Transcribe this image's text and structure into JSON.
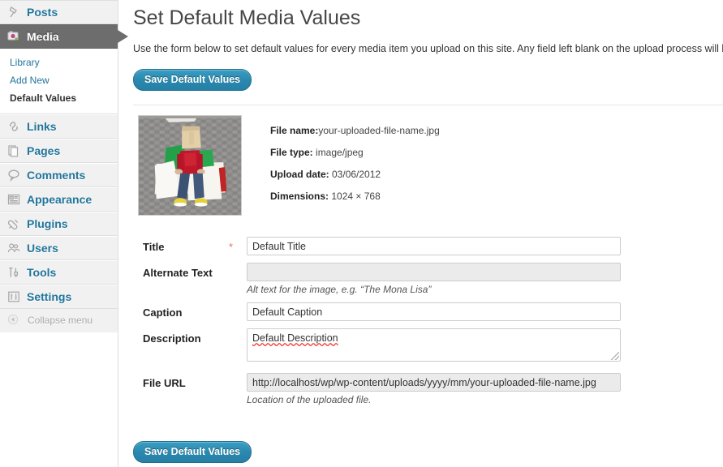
{
  "sidebar": {
    "items": [
      {
        "label": "Posts",
        "icon": "pin-icon",
        "name": "sidebar-item-posts",
        "current": false
      },
      {
        "label": "Media",
        "icon": "camera-icon",
        "name": "sidebar-item-media",
        "current": true
      },
      {
        "label": "Links",
        "icon": "link-icon",
        "name": "sidebar-item-links",
        "current": false
      },
      {
        "label": "Pages",
        "icon": "pages-icon",
        "name": "sidebar-item-pages",
        "current": false
      },
      {
        "label": "Comments",
        "icon": "comment-bubble-icon",
        "name": "sidebar-item-comments",
        "current": false
      },
      {
        "label": "Appearance",
        "icon": "appearance-icon",
        "name": "sidebar-item-appearance",
        "current": false
      },
      {
        "label": "Plugins",
        "icon": "plug-icon",
        "name": "sidebar-item-plugins",
        "current": false
      },
      {
        "label": "Users",
        "icon": "users-icon",
        "name": "sidebar-item-users",
        "current": false
      },
      {
        "label": "Tools",
        "icon": "tools-icon",
        "name": "sidebar-item-tools",
        "current": false
      },
      {
        "label": "Settings",
        "icon": "settings-sliders-icon",
        "name": "sidebar-item-settings",
        "current": false
      }
    ],
    "submenu": [
      {
        "label": "Library",
        "current": false
      },
      {
        "label": "Add New",
        "current": false
      },
      {
        "label": "Default Values",
        "current": true
      }
    ],
    "collapse": {
      "label": "Collapse menu",
      "icon": "collapse-arrow-icon"
    },
    "link_color": "#21759b",
    "current_bg": "#6d6d6d"
  },
  "main": {
    "title": "Set Default Media Values",
    "intro": "Use the form below to set default values for every media item you upload on this site. Any field left blank on the upload process will be",
    "save_label": "Save Default Values",
    "save_label_bottom": "Save Default Values",
    "accent_color": "#2a87ad"
  },
  "media": {
    "thumbnail_alt": "person with paper bag on head sitting on a white couch",
    "fields": [
      {
        "label": "File name:",
        "value": "your-uploaded-file-name.jpg"
      },
      {
        "label": "File type:",
        "value": " image/jpeg"
      },
      {
        "label": "Upload date:",
        "value": " 03/06/2012"
      },
      {
        "label": "Dimensions:",
        "value": " 1024 × 768"
      }
    ]
  },
  "form": {
    "title": {
      "label": "Title",
      "required": "*",
      "value": "Default Title",
      "placeholder": ""
    },
    "alt_text": {
      "label": "Alternate Text",
      "value": "",
      "placeholder": "",
      "hint": "Alt text for the image, e.g. “The Mona Lisa”"
    },
    "caption": {
      "label": "Caption",
      "value": "Default Caption",
      "placeholder": ""
    },
    "description": {
      "label": "Description",
      "value": "Default Description",
      "placeholder": ""
    },
    "file_url": {
      "label": "File URL",
      "value": "http://localhost/wp/wp-content/uploads/yyyy/mm/your-uploaded-file-name.jpg",
      "placeholder": "",
      "hint": "Location of the uploaded file."
    }
  }
}
